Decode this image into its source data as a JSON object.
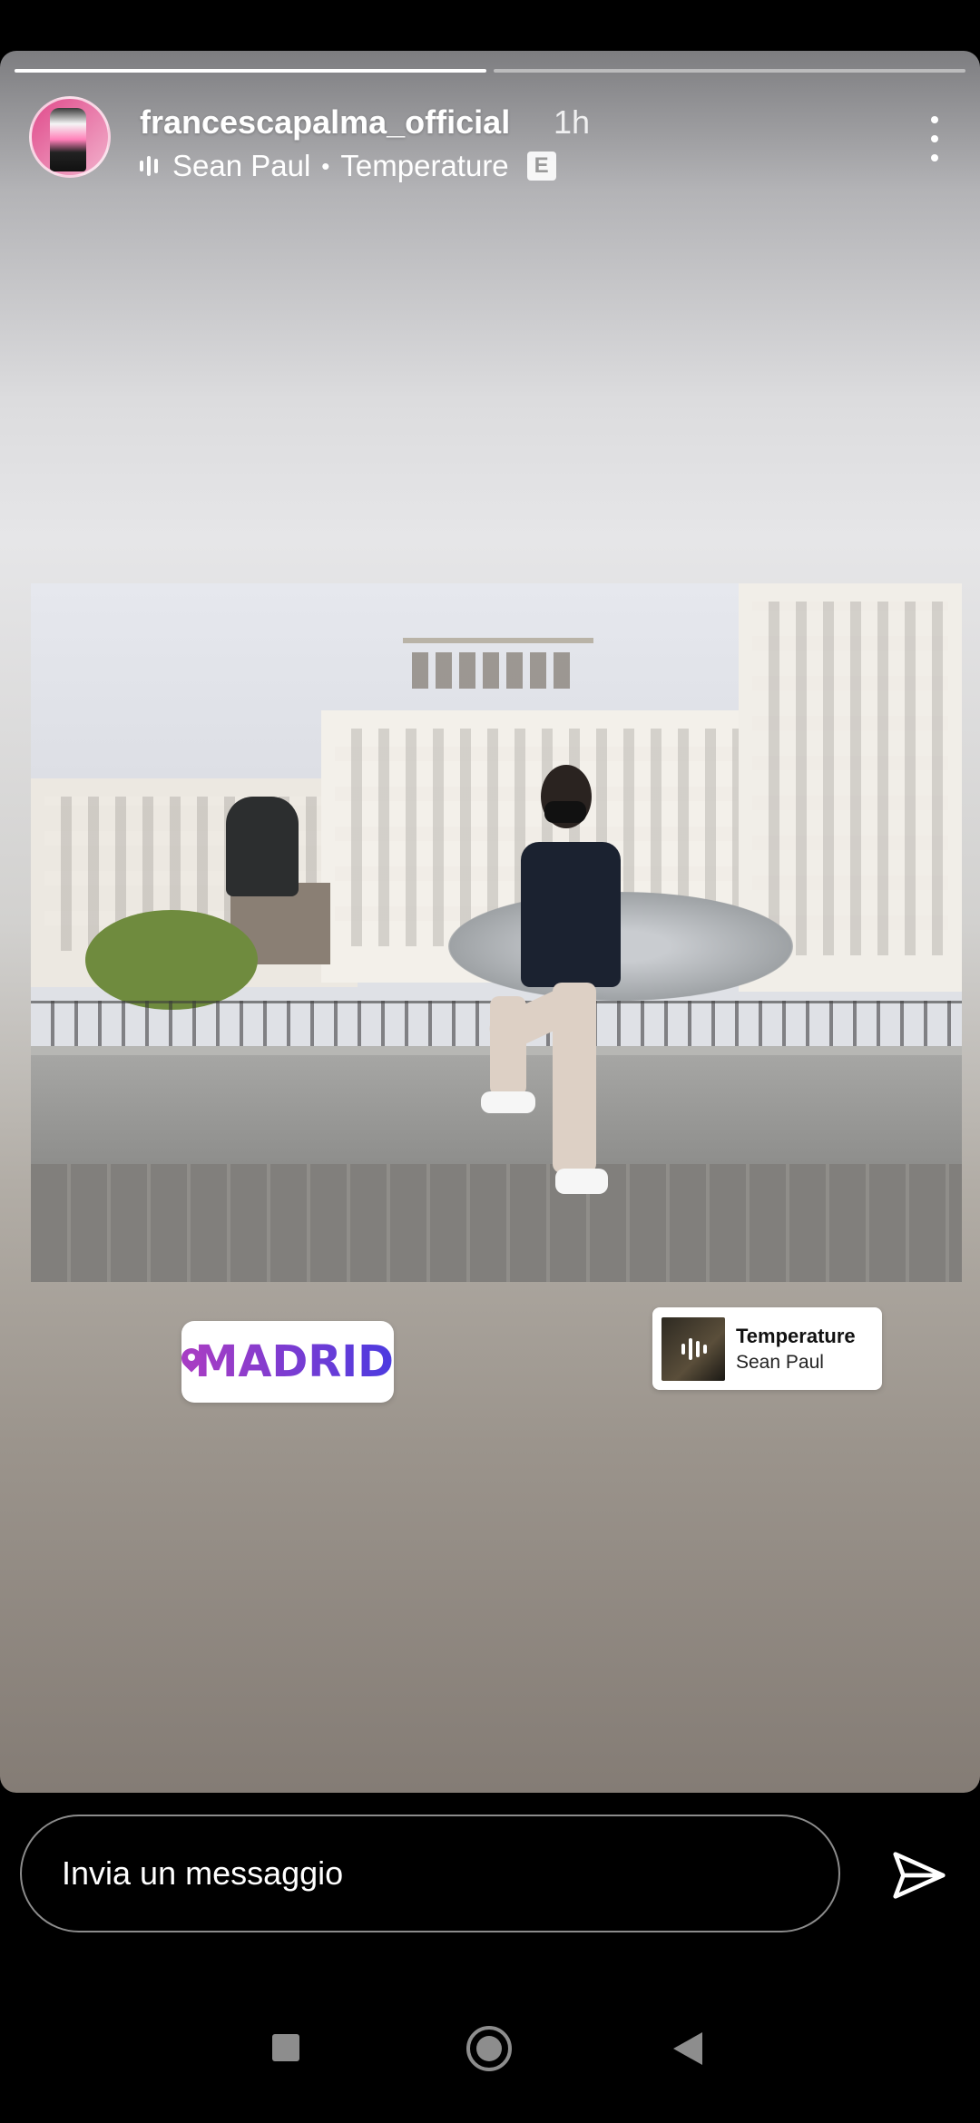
{
  "story": {
    "progress_segments": [
      1.0,
      0.0
    ],
    "username": "francescapalma_official",
    "time": "1h",
    "music": {
      "artist": "Sean Paul",
      "separator": "•",
      "track": "Temperature",
      "explicit_badge": "E"
    }
  },
  "stickers": {
    "location": {
      "label": "MADRID"
    },
    "music": {
      "title": "Temperature",
      "artist": "Sean Paul"
    }
  },
  "reply": {
    "placeholder": "Invia un messaggio"
  },
  "colors": {
    "location_gradient_start": "#a63dc4",
    "location_gradient_end": "#4b3be0"
  },
  "icons": {
    "more": "more-vert-icon",
    "send": "send-icon",
    "music_bars": "audio-bars-icon",
    "location_pin": "location-pin-icon"
  }
}
